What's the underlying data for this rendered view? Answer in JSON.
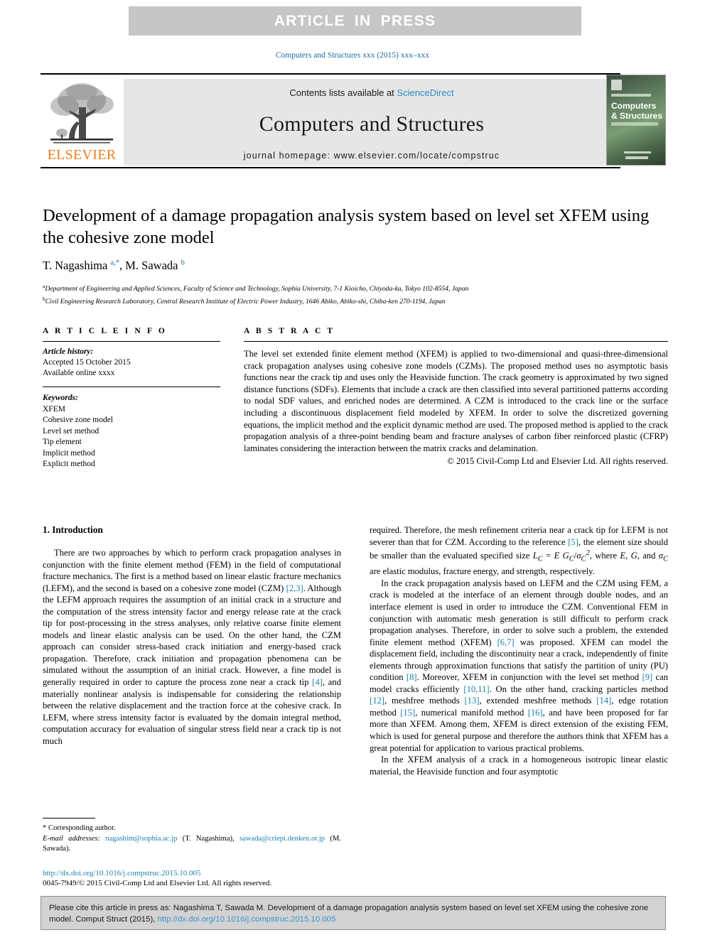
{
  "banner": {
    "text": "ARTICLE  IN  PRESS"
  },
  "running_head": "Computers and Structures xxx (2015) xxx–xxx",
  "masthead": {
    "contents_prefix": "Contents lists available at ",
    "sciencedirect": "ScienceDirect",
    "journal_title": "Computers and Structures",
    "homepage": "journal homepage: www.elsevier.com/locate/compstruc",
    "publisher": "ELSEVIER",
    "cover": {
      "line1": "Computers",
      "line2": "& Structures"
    }
  },
  "article": {
    "title": "Development of a damage propagation analysis system based on level set XFEM using the cohesive zone model",
    "authors_html": "T. Nagashima <sup>a,*</sup>, M. Sawada <sup>b</sup>",
    "affiliation_a": "Department of Engineering and Applied Sciences, Faculty of Science and Technology, Sophia University, 7-1 Kioicho, Chiyoda-ku, Tokyo 102-8554, Japan",
    "affiliation_b": "Civil Engineering Research Laboratory, Central Research Institute of Electric Power Industry, 1646 Abiko, Abiko-shi, Chiba-ken 270-1194, Japan"
  },
  "info": {
    "heading": "A R T I C L E   I N F O",
    "history_label": "Article history:",
    "history_lines": [
      "Accepted 15 October 2015",
      "Available online xxxx"
    ],
    "keywords_label": "Keywords:",
    "keywords": [
      "XFEM",
      "Cohesive zone model",
      "Level set method",
      "Tip element",
      "Implicit method",
      "Explicit method"
    ]
  },
  "abstract": {
    "heading": "A B S T R A C T",
    "body": "The level set extended finite element method (XFEM) is applied to two-dimensional and quasi-three-dimensional crack propagation analyses using cohesive zone models (CZMs). The proposed method uses no asymptotic basis functions near the crack tip and uses only the Heaviside function. The crack geometry is approximated by two signed distance functions (SDFs). Elements that include a crack are then classified into several partitioned patterns according to nodal SDF values, and enriched nodes are determined. A CZM is introduced to the crack line or the surface including a discontinuous displacement field modeled by XFEM. In order to solve the discretized governing equations, the implicit method and the explicit dynamic method are used. The proposed method is applied to the crack propagation analysis of a three-point bending beam and fracture analyses of carbon fiber reinforced plastic (CFRP) laminates considering the interaction between the matrix cracks and delamination.",
    "copyright": "© 2015 Civil-Comp Ltd and Elsevier Ltd. All rights reserved."
  },
  "body": {
    "section_heading": "1. Introduction",
    "left_p1_html": "There are two approaches by which to perform crack propagation analyses in conjunction with the finite element method (FEM) in the field of computational fracture mechanics. The first is a method based on linear elastic fracture mechanics (LEFM), and the second is based on a cohesive zone model (CZM) <span class=\"ref\">[2,3]</span>. Although the LEFM approach requires the assumption of an initial crack in a structure and the computation of the stress intensity factor and energy release rate at the crack tip for post-processing in the stress analyses, only relative coarse finite element models and linear elastic analysis can be used. On the other hand, the CZM approach can consider stress-based crack initiation and energy-based crack propagation. Therefore, crack initiation and propagation phenomena can be simulated without the assumption of an initial crack. However, a fine model is generally required in order to capture the process zone near a crack tip <span class=\"ref\">[4]</span>, and materially nonlinear analysis is indispensable for considering the relationship between the relative displacement and the traction force at the cohesive crack. In LEFM, where stress intensity factor is evaluated by the domain integral method, computation accuracy for evaluation of singular stress field near a crack tip is not much",
    "right_p1_html": "required. Therefore, the mesh refinement criteria near a crack tip for LEFM is not severer than that for CZM. According to the reference <span class=\"ref\">[5]</span>, the element size should be smaller than the evaluated specified size <span class=\"mathi\">L<sub>C</sub></span> = <span class=\"mathi\">E G<sub>C</sub></span>/<span class=\"mathi\">&sigma;<sub>C</sub><sup>2</sup></span>, where <span class=\"mathi\">E</span>, <span class=\"mathi\">G</span>, and <span class=\"mathi\">&sigma;<sub>C</sub></span> are elastic modulus, fracture energy, and strength, respectively.",
    "right_p2_html": "In the crack propagation analysis based on LEFM and the CZM using FEM, a crack is modeled at the interface of an element through double nodes, and an interface element is used in order to introduce the CZM. Conventional FEM in conjunction with automatic mesh generation is still difficult to perform crack propagation analyses. Therefore, in order to solve such a problem, the extended finite element method (XFEM) <span class=\"ref\">[6,7]</span> was proposed. XFEM can model the displacement field, including the discontinuity near a crack, independently of finite elements through approximation functions that satisfy the partition of unity (PU) condition <span class=\"ref\">[8]</span>. Moreover, XFEM in conjunction with the level set method <span class=\"ref\">[9]</span> can model cracks efficiently <span class=\"ref\">[10,11]</span>. On the other hand, cracking particles method <span class=\"ref\">[12]</span>, meshfree methods <span class=\"ref\">[13]</span>, extended meshfree methods <span class=\"ref\">[14]</span>, edge rotation method <span class=\"ref\">[15]</span>, numerical manifold method <span class=\"ref\">[16]</span>, and have been proposed for far more than XFEM. Among them, XFEM is direct extension of the existing FEM, which is used for general purpose and therefore the authors think that XFEM has a great potential for application to various practical problems.",
    "right_p3_html": "In the XFEM analysis of a crack in a homogeneous isotropic linear elastic material, the Heaviside function and four asymptotic"
  },
  "footnote": {
    "corresponding": "* Corresponding author.",
    "emails_html": "<span class=\"lbl\">E-mail addresses:</span> <span class=\"blue\">nagashim@sophia.ac.jp</span> (T. Nagashima), <span class=\"blue\">sawada@criepi.denken.or.jp</span> (M. Sawada).",
    "doi": "http://dx.doi.org/10.1016/j.compstruc.2015.10.005",
    "issn_line": "0045-7949/© 2015 Civil-Comp Ltd and Elsevier Ltd. All rights reserved."
  },
  "citation_box": {
    "html": "Please cite this article in press as: Nagashima T, Sawada M. Development of a damage propagation analysis system based on level set XFEM using the cohesive zone model. Comput Struct (2015), <span class=\"blue\">http://dx.doi.org/10.1016/j.compstruc.2015.10.005</span>"
  },
  "colors": {
    "banner_bg": "#c6c6c6",
    "link_blue": "#1a7fa8",
    "elsevier_orange": "#f07d1a",
    "masthead_band": "#e6e6e6",
    "citation_bg": "#d2d2d2"
  }
}
